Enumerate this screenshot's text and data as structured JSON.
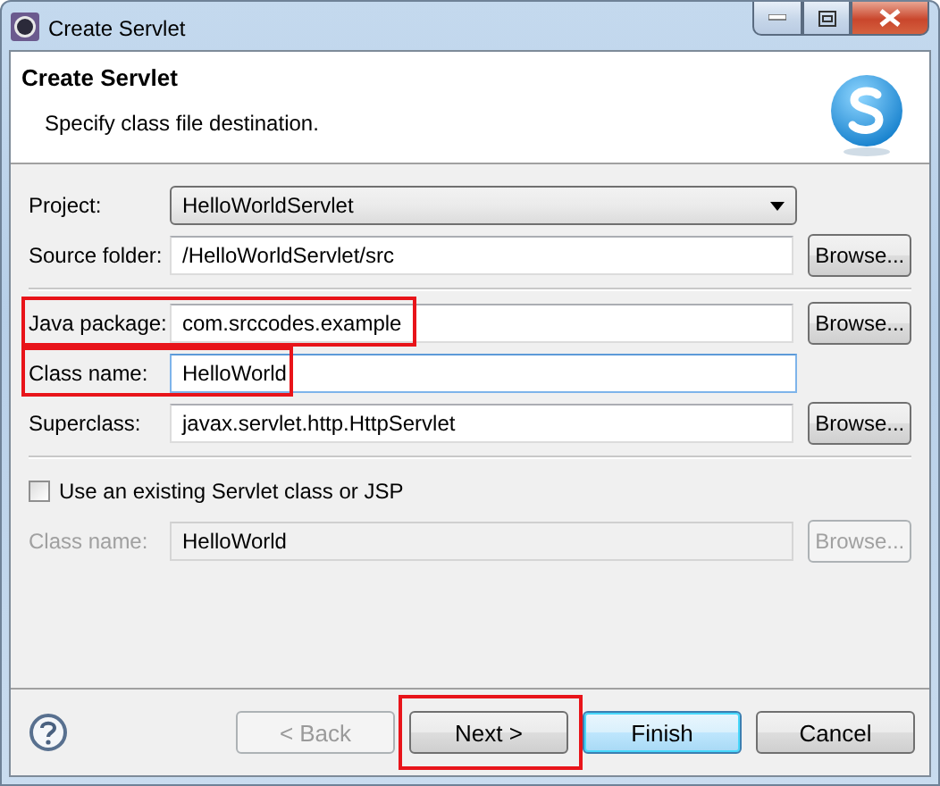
{
  "window": {
    "title": "Create Servlet"
  },
  "header": {
    "title": "Create Servlet",
    "description": "Specify class file destination."
  },
  "sections": [
    {
      "fields": [
        {
          "kind": "combo",
          "label": "Project:",
          "value": "HelloWorldServlet",
          "highlighted": false
        },
        {
          "kind": "text",
          "label": "Source folder:",
          "value": "/HelloWorldServlet/src",
          "browse": "Browse...",
          "disabled": false,
          "focused": false,
          "highlighted": false
        }
      ]
    },
    {
      "fields": [
        {
          "kind": "text",
          "label": "Java package:",
          "value": "com.srccodes.example",
          "browse": "Browse...",
          "disabled": false,
          "focused": false,
          "highlighted": true
        },
        {
          "kind": "text",
          "label": "Class name:",
          "value": "HelloWorld",
          "disabled": false,
          "focused": true,
          "highlighted": true
        },
        {
          "kind": "text",
          "label": "Superclass:",
          "value": "javax.servlet.http.HttpServlet",
          "browse": "Browse...",
          "disabled": false,
          "focused": false,
          "highlighted": false
        }
      ]
    },
    {
      "fields": [
        {
          "kind": "checkbox",
          "label": "Use an existing Servlet class or JSP",
          "checked": false
        },
        {
          "kind": "text",
          "label": "Class name:",
          "value": "HelloWorld",
          "browse": "Browse...",
          "disabled": true,
          "focused": false,
          "highlighted": false
        }
      ]
    }
  ],
  "buttons": [
    {
      "label": "< Back",
      "disabled": true,
      "default": false,
      "highlighted": false
    },
    {
      "label": "Next >",
      "disabled": false,
      "default": false,
      "highlighted": true
    },
    {
      "label": "Finish",
      "disabled": false,
      "default": true,
      "highlighted": false
    },
    {
      "label": "Cancel",
      "disabled": false,
      "default": false,
      "highlighted": false
    }
  ]
}
